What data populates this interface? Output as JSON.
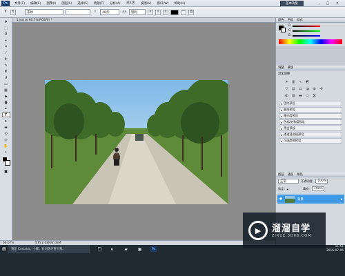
{
  "menubar": {
    "logo": "Ps",
    "items": [
      "文件(F)",
      "编辑(E)",
      "图像(I)",
      "图层(L)",
      "选择(S)",
      "滤镜(T)",
      "分析(A)",
      "3D(D)",
      "视图(V)",
      "窗口(W)",
      "帮助(H)"
    ],
    "essentials": "基本功能",
    "minimize": "–",
    "restore": "□",
    "close": "✕"
  },
  "options": {
    "tool_glyph": "T",
    "font_family": "宋体",
    "font_style": "-",
    "font_size": "48点",
    "aa_label": "aa",
    "aa_mode": "锐利"
  },
  "document": {
    "tab_title": "1.jpg @ 66.7%(RGB/8) *"
  },
  "statusbar": {
    "zoom": "66.67%",
    "doc_size": "文档:2.08M/2.08M"
  },
  "panels": {
    "color_tabs": [
      "颜色",
      "色板",
      "样式"
    ],
    "channels": [
      "R",
      "G",
      "B"
    ],
    "adjust_tabs": [
      "调整",
      "蒙版"
    ],
    "adjust_title": "添加调整",
    "presets": [
      "色阶预设",
      "曲线预设",
      "曝光度预设",
      "色相/饱和度预设",
      "黑白预设",
      "通道混合器预设",
      "可选颜色预设"
    ],
    "layers_tabs": [
      "图层",
      "通道",
      "路径"
    ],
    "blend_mode": "正常",
    "opacity_label": "不透明度:",
    "opacity": "100%",
    "lock_label": "锁定:",
    "fill_label": "填充:",
    "fill": "100%",
    "layer_name": "背景"
  },
  "taskbar": {
    "start_glyph": "⊞",
    "search_placeholder": "我是 Cortana，小娜。有问题尽管问我。",
    "time": "11:51",
    "date": "2016-07-06"
  },
  "watermark": {
    "title": "溜溜自学",
    "url": "ZIXUE.3D66.COM"
  }
}
